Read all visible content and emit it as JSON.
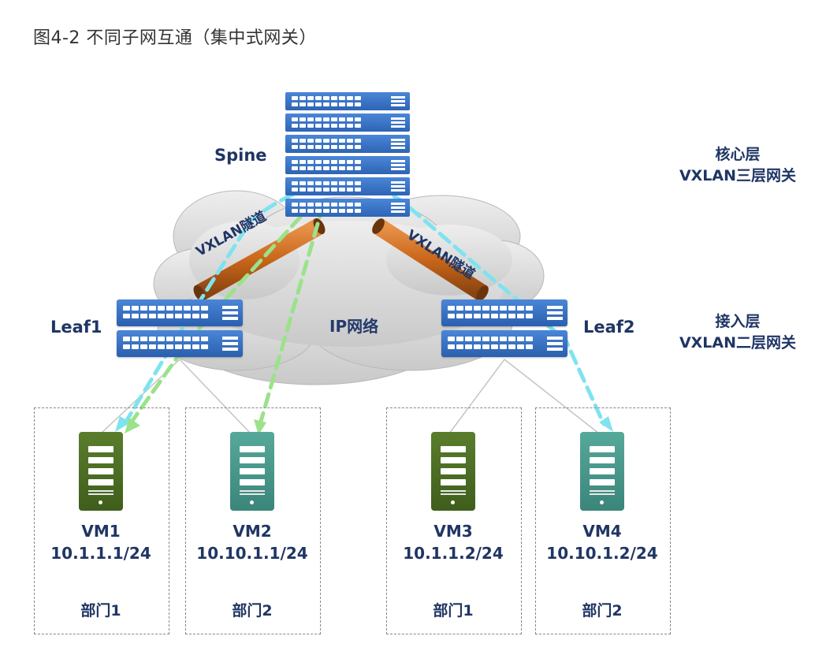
{
  "caption": "图4-2 不同子网互通（集中式网关）",
  "spine": {
    "label": "Spine"
  },
  "core_layer": {
    "name": "核心层",
    "role": "VXLAN三层网关"
  },
  "access_layer": {
    "name": "接入层",
    "role": "VXLAN二层网关"
  },
  "leaf1": {
    "label": "Leaf1"
  },
  "leaf2": {
    "label": "Leaf2"
  },
  "network": {
    "label": "IP网络"
  },
  "tunnels": [
    {
      "label": "VXLAN隧道"
    },
    {
      "label": "VXLAN隧道"
    }
  ],
  "vms": [
    {
      "name": "VM1",
      "ip": "10.1.1.1/24",
      "dept": "部门1"
    },
    {
      "name": "VM2",
      "ip": "10.10.1.1/24",
      "dept": "部门2"
    },
    {
      "name": "VM3",
      "ip": "10.1.1.2/24",
      "dept": "部门1"
    },
    {
      "name": "VM4",
      "ip": "10.10.1.2/24",
      "dept": "部门2"
    }
  ],
  "colors": {
    "switch_blue": "#3a73c8",
    "tunnel_orange": "#d0701f",
    "path_cyan": "#7fe3ef",
    "path_green": "#9be28a",
    "server_green": "#4f7026",
    "server_teal": "#4b9a8c",
    "label_navy": "#1f3564"
  }
}
